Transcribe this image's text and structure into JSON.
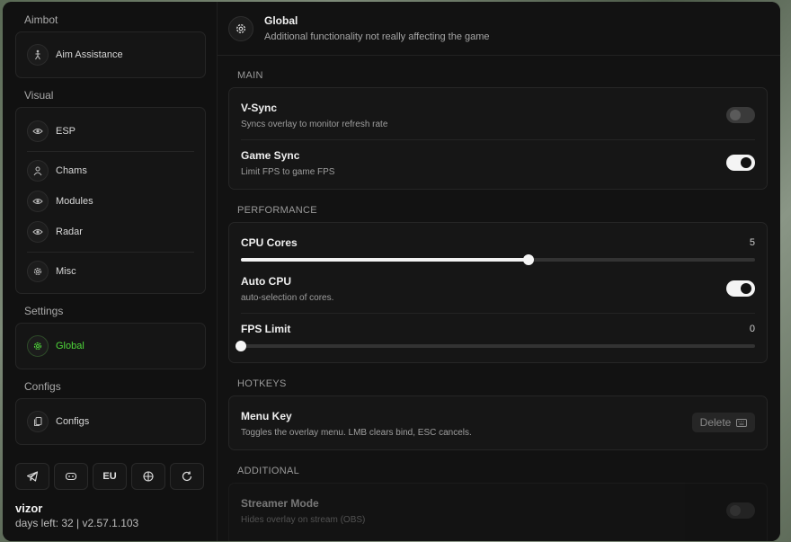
{
  "sidebar": {
    "sections": [
      {
        "title": "Aimbot",
        "items": [
          {
            "label": "Aim Assistance",
            "icon": "figure-icon"
          }
        ]
      },
      {
        "title": "Visual",
        "items": [
          {
            "label": "ESP",
            "icon": "eye-icon"
          },
          {
            "label": "Chams",
            "icon": "user-icon"
          },
          {
            "label": "Modules",
            "icon": "eye-icon"
          },
          {
            "label": "Radar",
            "icon": "eye-icon"
          },
          {
            "label": "Misc",
            "icon": "gear-icon"
          }
        ]
      },
      {
        "title": "Settings",
        "items": [
          {
            "label": "Global",
            "icon": "gear-icon",
            "active": true
          }
        ]
      },
      {
        "title": "Configs",
        "items": [
          {
            "label": "Configs",
            "icon": "files-icon"
          }
        ]
      }
    ],
    "bottom_buttons": [
      {
        "icon": "telegram-icon"
      },
      {
        "icon": "gamepad-icon"
      },
      {
        "label": "EU"
      },
      {
        "icon": "crosshair-icon"
      },
      {
        "icon": "refresh-icon"
      }
    ],
    "user": {
      "name": "vizor",
      "info": "days left: 32 | v2.57.1.103"
    }
  },
  "header": {
    "title": "Global",
    "subtitle": "Additional functionality not really affecting the game"
  },
  "main": {
    "main_section": {
      "title": "MAIN",
      "rows": [
        {
          "title": "V-Sync",
          "desc": "Syncs overlay to monitor refresh rate",
          "on": false
        },
        {
          "title": "Game Sync",
          "desc": "Limit FPS to game FPS",
          "on": true
        }
      ]
    },
    "performance": {
      "title": "PERFORMANCE",
      "cpu_cores": {
        "title": "CPU Cores",
        "value": "5",
        "fraction": 0.56
      },
      "auto_cpu": {
        "title": "Auto CPU",
        "desc": "auto-selection of cores.",
        "on": true
      },
      "fps_limit": {
        "title": "FPS Limit",
        "value": "0",
        "fraction": 0.0
      }
    },
    "hotkeys": {
      "title": "HOTKEYS",
      "menu_key": {
        "title": "Menu Key",
        "desc": "Toggles the overlay menu. LMB clears bind, ESC cancels.",
        "button": "Delete"
      }
    },
    "additional": {
      "title": "ADDITIONAL",
      "streamer": {
        "title": "Streamer Mode",
        "desc": "Hides overlay on stream (OBS)",
        "on": false
      }
    }
  },
  "colors": {
    "accent": "#4fd63a",
    "background": "#121212",
    "card": "#161616"
  }
}
